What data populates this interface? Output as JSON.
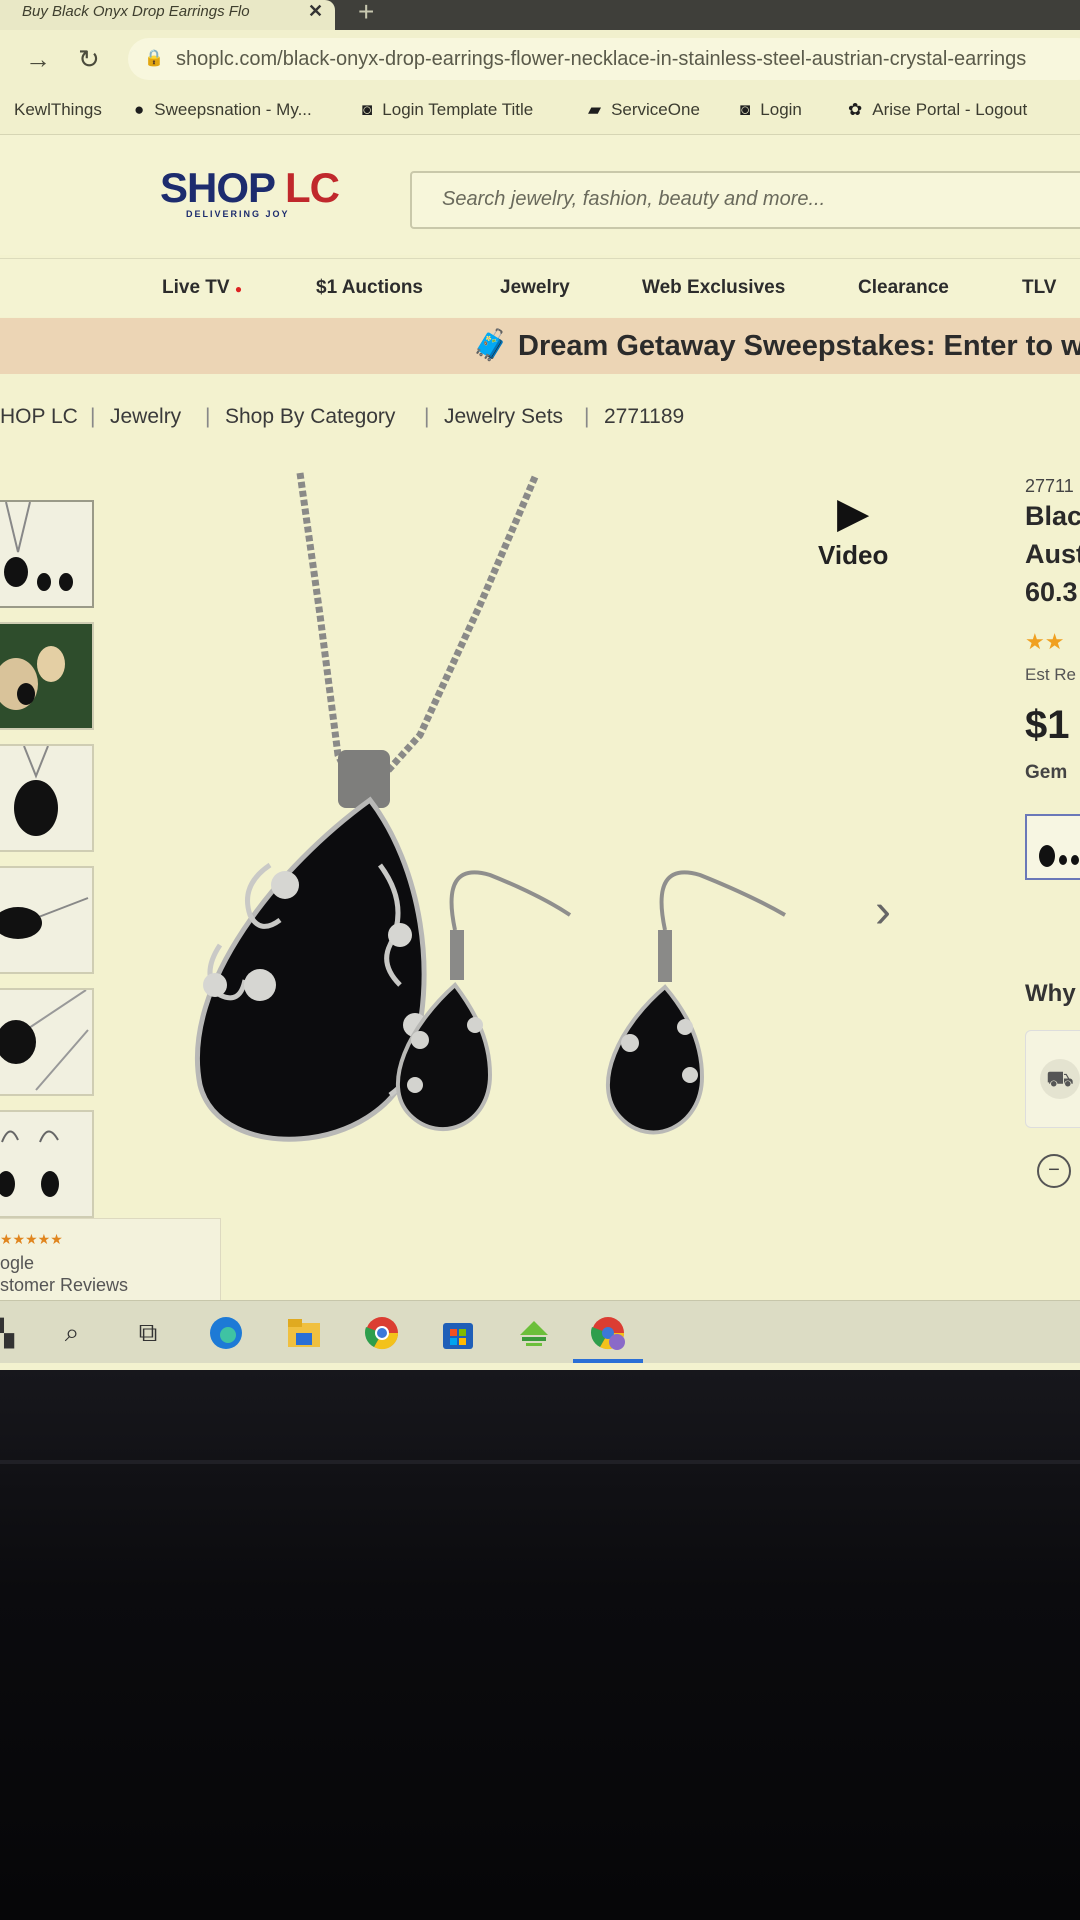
{
  "browser": {
    "tab_title": "Buy Black Onyx Drop Earrings Flo",
    "url": "shoplc.com/black-onyx-drop-earrings-flower-necklace-in-stainless-steel-austrian-crystal-earrings",
    "bookmarks": [
      "KewlThings",
      "Sweepsnation - My...",
      "Login Template Title",
      "ServiceOne",
      "Login",
      "Arise Portal - Logout"
    ]
  },
  "site": {
    "logo_shop": "SHOP",
    "logo_lc": "LC",
    "tagline": "DELIVERING JOY",
    "search_placeholder": "Search jewelry, fashion, beauty and more...",
    "nav": [
      "Live TV",
      "$1 Auctions",
      "Jewelry",
      "Web Exclusives",
      "Clearance",
      "TLV"
    ],
    "promo": "Dream Getaway Sweepstakes: Enter to wi"
  },
  "breadcrumb": [
    "HOP LC",
    "Jewelry",
    "Shop By Category",
    "Jewelry Sets",
    "2771189"
  ],
  "product": {
    "video_label": "Video",
    "sku_partial": "27711",
    "title_lines": [
      "Blac",
      "Aust",
      "60.3"
    ],
    "stars": "★★",
    "est_label": "Est Re",
    "price_partial": "$1",
    "gem_label": "Gem",
    "why_label": "Why"
  },
  "reviews": {
    "stars": "★★★★★",
    "line1": "ogle",
    "line2": "stomer Reviews"
  },
  "colors": {
    "screen_bg": "#f3f2cf",
    "logo_blue": "#1d2c6e",
    "logo_red": "#c0282c",
    "promo_bg": "#ecd5b5"
  }
}
